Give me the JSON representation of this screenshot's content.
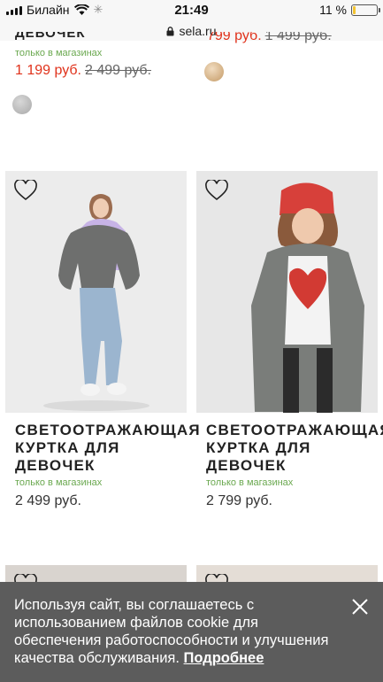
{
  "status_bar": {
    "carrier": "Билайн",
    "time": "21:49",
    "battery": "11 %",
    "battery_level": 0.11
  },
  "url": "sela.ru",
  "top_products": [
    {
      "title_partial": "ДЕВОЧЕК",
      "availability": "только в магазинах",
      "price": "1 199 руб.",
      "old_price": "2 499 руб.",
      "swatch_color": "#bdbdbd"
    },
    {
      "price": "799 руб.",
      "old_price": "1 499 руб.",
      "swatch_color": "#d6b48c"
    }
  ],
  "products": [
    {
      "name": "СВЕТООТРАЖАЮЩАЯ КУРТКА ДЛЯ ДЕВОЧЕК",
      "availability": "только в магазинах",
      "price": "2 499 руб."
    },
    {
      "name": "СВЕТООТРАЖАЮЩАЯ КУРТКА ДЛЯ ДЕВОЧЕК",
      "availability": "только в магазинах",
      "price": "2 799 руб."
    }
  ],
  "cookie_banner": {
    "text": "Используя сайт, вы соглашаетесь с использованием файлов cookie для обеспечения работоспособности и улучшения качества обслуживания.",
    "link": "Подробнее"
  },
  "colors": {
    "sale": "#e0321b",
    "available": "#6aa84f",
    "banner": "#505050",
    "battery": "#f3c431"
  }
}
